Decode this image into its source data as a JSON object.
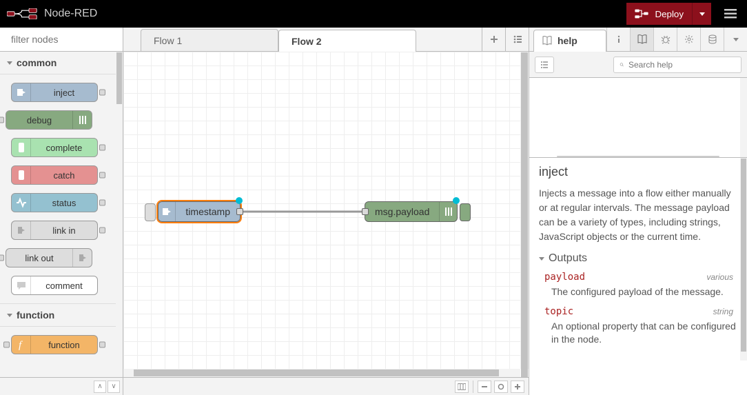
{
  "header": {
    "title": "Node-RED",
    "deploy_label": "Deploy"
  },
  "palette": {
    "search_placeholder": "filter nodes",
    "categories": [
      {
        "name": "common",
        "nodes": [
          {
            "label": "inject"
          },
          {
            "label": "debug"
          },
          {
            "label": "complete"
          },
          {
            "label": "catch"
          },
          {
            "label": "status"
          },
          {
            "label": "link in"
          },
          {
            "label": "link out"
          },
          {
            "label": "comment"
          }
        ]
      },
      {
        "name": "function",
        "nodes": [
          {
            "label": "function"
          }
        ]
      }
    ]
  },
  "workspace": {
    "tabs": [
      {
        "label": "Flow 1",
        "active": false
      },
      {
        "label": "Flow 2",
        "active": true
      }
    ],
    "nodes": [
      {
        "label": "timestamp"
      },
      {
        "label": "msg.payload"
      }
    ]
  },
  "sidebar": {
    "title": "help",
    "search_placeholder": "Search help",
    "help": {
      "node_title": "inject",
      "description": "Injects a message into a flow either manually or at regular intervals. The message payload can be a variety of types, including strings, JavaScript objects or the current time.",
      "outputs_title": "Outputs",
      "outputs": [
        {
          "name": "payload",
          "type": "various",
          "desc": "The configured payload of the message."
        },
        {
          "name": "topic",
          "type": "string",
          "desc": "An optional property that can be configured in the node."
        }
      ]
    }
  }
}
